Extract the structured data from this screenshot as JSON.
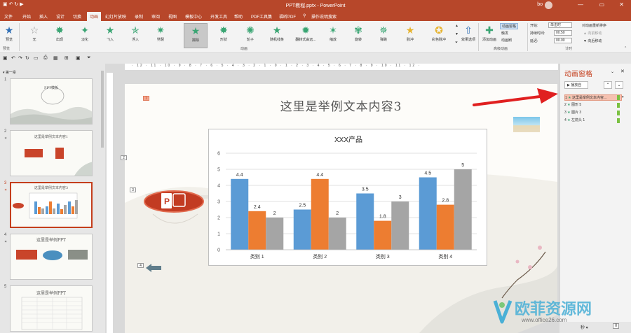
{
  "window": {
    "title": "PPT教程.pptx - PowerPoint",
    "user": "bo",
    "min": "—",
    "restore": "▭",
    "close": "✕"
  },
  "tabs": [
    "文件",
    "开始",
    "插入",
    "设计",
    "切换",
    "动画",
    "幻灯片放映",
    "录制",
    "审阅",
    "视图",
    "模板中心",
    "开发工具",
    "帮助",
    "PDF工具集",
    "福昕PDF",
    "操作说明搜索"
  ],
  "active_tab": "动画",
  "ribbon": {
    "preview_label": "预览",
    "preview_group": "预览",
    "animations": [
      "无",
      "出现",
      "淡化",
      "飞入",
      "浮入",
      "劈裂",
      "擦除",
      "形状",
      "轮子",
      "随机线条",
      "翻转式由远...",
      "缩放",
      "旋转",
      "弹跳",
      "脉冲",
      "彩色脉冲"
    ],
    "selected_animation": "擦除",
    "effect_options": "效果选项",
    "animation_group": "动画",
    "add_animation": "添加动画",
    "animation_pane": "动画窗格",
    "trigger": "触发",
    "animation_painter": "动画刷",
    "advanced_group": "高级动画",
    "start_label": "开始:",
    "start_value": "单击时",
    "duration_label": "持续时间:",
    "duration_value": "00.50",
    "delay_label": "延迟:",
    "delay_value": "00.00",
    "reorder_title": "对动画重新排序",
    "move_earlier": "▲ 向前移动",
    "move_later": "▼ 向后移动",
    "timing_group": "计时"
  },
  "thumbnails": {
    "section": "第一章",
    "slides": [
      {
        "num": "1",
        "title": "PPT模板"
      },
      {
        "num": "2",
        "title": "这里是举例文本内容1"
      },
      {
        "num": "3",
        "title": "这里是举例文本内容3"
      },
      {
        "num": "4",
        "title": "这里是举例PPT"
      },
      {
        "num": "5",
        "title": "这里是举例PPT"
      }
    ]
  },
  "ruler": "· 12 · 11 · 10 · 9 · 8 · 7 · 6 · 5 · 4 · 3 · 2 · 1 · 0 · 1 · 2 · 3 · 4 · 5 · 6 · 7 · 8 · 9 · 10 · 11 · 12 ·",
  "slide": {
    "title": "这里是举例文本内容3",
    "tags": [
      "1",
      "2",
      "3",
      "4"
    ]
  },
  "chart_data": {
    "type": "bar",
    "title": "XXX产品",
    "categories": [
      "类别 1",
      "类别 2",
      "类别 3",
      "类别 4"
    ],
    "series": [
      {
        "values": [
          4.4,
          2.5,
          3.5,
          4.5
        ],
        "color": "#5b9bd5"
      },
      {
        "values": [
          2.4,
          4.4,
          1.8,
          2.8
        ],
        "color": "#ed7d31"
      },
      {
        "values": [
          2,
          2,
          3,
          5
        ],
        "color": "#a5a5a5"
      }
    ],
    "ylim": [
      0,
      6
    ],
    "yticks": [
      "0",
      "1",
      "2",
      "3",
      "4",
      "5",
      "6"
    ],
    "grid": true
  },
  "anim_pane": {
    "title": "动画窗格",
    "play": "播放自",
    "items": [
      {
        "num": "1",
        "label": "这里是举例文本内容..."
      },
      {
        "num": "2",
        "label": "图形 5"
      },
      {
        "num": "3",
        "label": "图片 3"
      },
      {
        "num": "4",
        "label": "左箭头 1"
      }
    ]
  },
  "watermark": {
    "brand": "欧菲资源网",
    "url": "www.office26.com"
  },
  "status": {
    "zoom_label": "秒 ▾"
  },
  "colors": {
    "brand": "#b7472a",
    "accent": "#c43e1c",
    "anim_icon": "#3aa573"
  }
}
